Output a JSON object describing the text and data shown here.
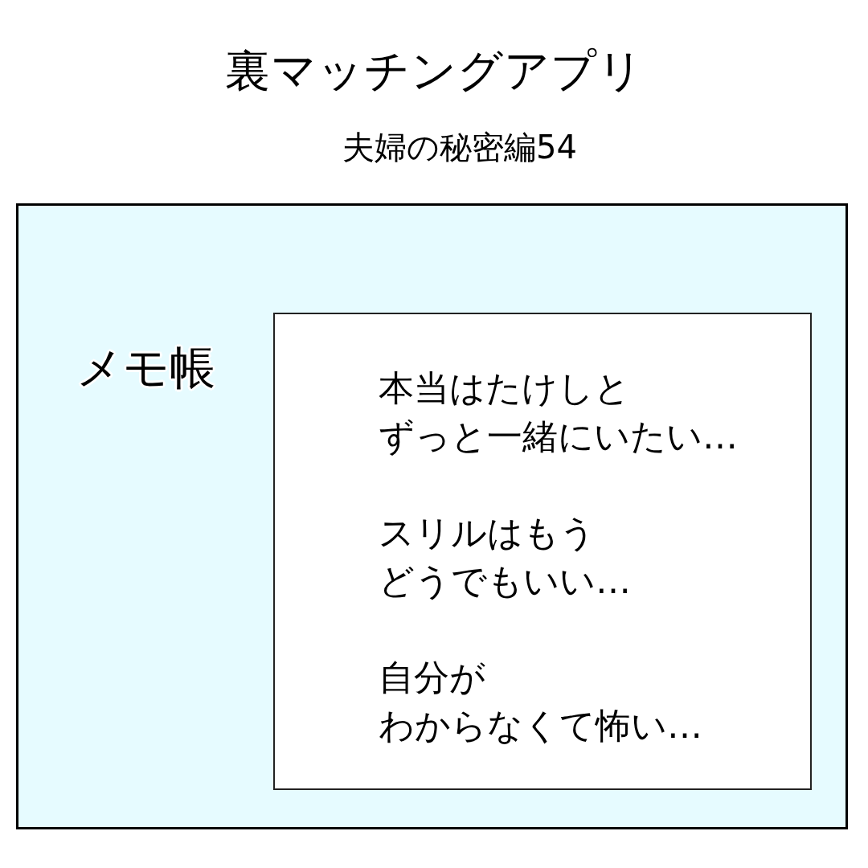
{
  "title": "裏マッチングアプリ",
  "subtitle": "夫婦の秘密編54",
  "panel": {
    "label": "メモ帳",
    "note": {
      "paragraphs": [
        [
          "本当はたけしと",
          "ずっと一緒にいたい…"
        ],
        [
          "スリルはもう",
          "どうでもいい…"
        ],
        [
          "自分が",
          "わからなくて怖い…"
        ]
      ]
    }
  }
}
